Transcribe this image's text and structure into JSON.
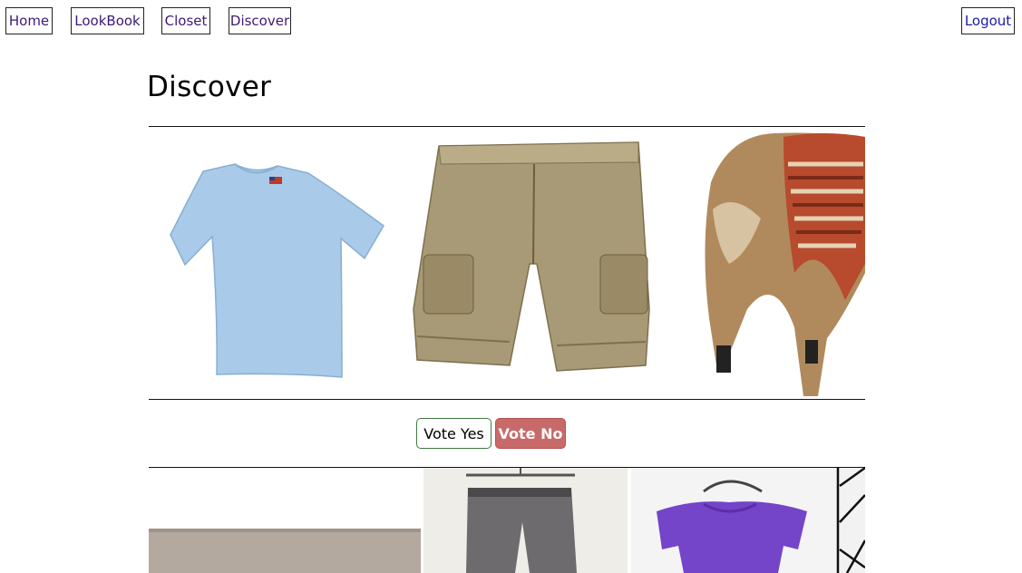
{
  "nav": {
    "home": "Home",
    "lookbook": "LookBook",
    "closet": "Closet",
    "discover": "Discover",
    "logout": "Logout"
  },
  "page": {
    "title": "Discover"
  },
  "outfit": {
    "items": [
      {
        "name": "light blue t-shirt",
        "color": "#a9cbe9"
      },
      {
        "name": "khaki cargo shorts",
        "color": "#a89a76"
      },
      {
        "name": "fur trapper hat",
        "color": "#b08a5c"
      }
    ]
  },
  "vote": {
    "yes_label": "Vote Yes",
    "no_label": "Vote No"
  },
  "feed": {
    "items": [
      {
        "name": "gray textured item",
        "color": "#b3a99f"
      },
      {
        "name": "gray pinstripe trousers",
        "color": "#6d6b6e"
      },
      {
        "name": "purple top",
        "color": "#7444c9"
      },
      {
        "name": "geometric pattern item",
        "color": "#111111"
      }
    ]
  },
  "colors": {
    "nav_text": "#3b1a78",
    "logout_text": "#1a1aa8",
    "vote_no_bg": "#c96a6a",
    "vote_yes_border": "#3f7a3f"
  }
}
